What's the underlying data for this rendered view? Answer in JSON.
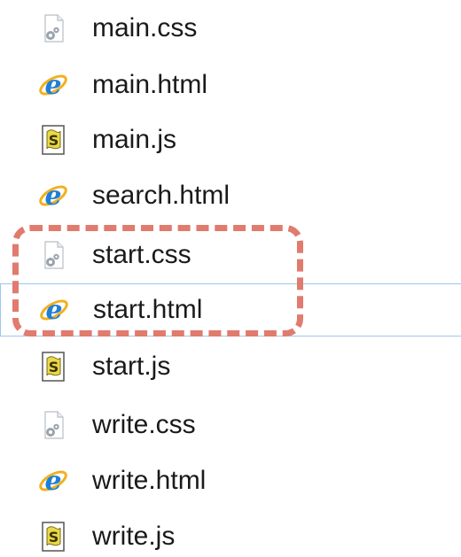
{
  "files": [
    {
      "name": "main.css",
      "type": "css",
      "icon": "css-file-icon"
    },
    {
      "name": "main.html",
      "type": "html",
      "icon": "html-file-icon"
    },
    {
      "name": "main.js",
      "type": "js",
      "icon": "js-file-icon"
    },
    {
      "name": "search.html",
      "type": "html",
      "icon": "html-file-icon"
    },
    {
      "name": "start.css",
      "type": "css",
      "icon": "css-file-icon"
    },
    {
      "name": "start.html",
      "type": "html",
      "icon": "html-file-icon",
      "focused": true
    },
    {
      "name": "start.js",
      "type": "js",
      "icon": "js-file-icon"
    },
    {
      "name": "write.css",
      "type": "css",
      "icon": "css-file-icon"
    },
    {
      "name": "write.html",
      "type": "html",
      "icon": "html-file-icon"
    },
    {
      "name": "write.js",
      "type": "js",
      "icon": "js-file-icon"
    }
  ],
  "annotation": {
    "style": "dashed",
    "color": "#e07b6e",
    "highlights": [
      "start.css",
      "start.html"
    ]
  },
  "colors": {
    "focus_border": "#99c8f0",
    "ie_blue": "#1e7fd6",
    "ie_ring": "#f2b01e",
    "js_yellow": "#e8d84a",
    "css_gray": "#9aa3ad"
  }
}
